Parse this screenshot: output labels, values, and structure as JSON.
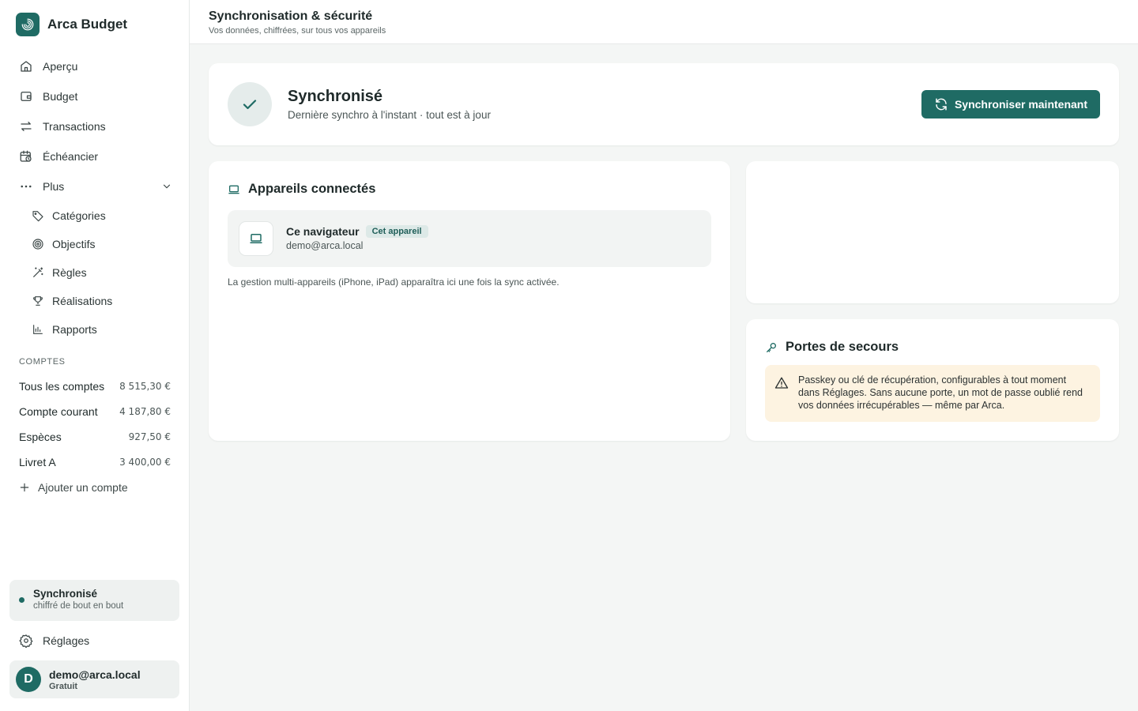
{
  "brand": {
    "name": "Arca Budget"
  },
  "nav": {
    "items": [
      {
        "label": "Aperçu"
      },
      {
        "label": "Budget"
      },
      {
        "label": "Transactions"
      },
      {
        "label": "Échéancier"
      },
      {
        "label": "Plus"
      }
    ],
    "sub_items": [
      {
        "label": "Catégories"
      },
      {
        "label": "Objectifs"
      },
      {
        "label": "Règles"
      },
      {
        "label": "Réalisations"
      },
      {
        "label": "Rapports"
      }
    ]
  },
  "accounts": {
    "title": "COMPTES",
    "items": [
      {
        "name": "Tous les comptes",
        "amount": "8 515,30 €"
      },
      {
        "name": "Compte courant",
        "amount": "4 187,80 €"
      },
      {
        "name": "Espèces",
        "amount": "927,50 €"
      },
      {
        "name": "Livret A",
        "amount": "3 400,00 €"
      }
    ],
    "add_label": "Ajouter un compte"
  },
  "sidebar_sync": {
    "title": "Synchronisé",
    "subtitle": "chiffré de bout en bout"
  },
  "settings_label": "Réglages",
  "user": {
    "initial": "D",
    "email": "demo@arca.local",
    "plan": "Gratuit"
  },
  "header": {
    "title": "Synchronisation & sécurité",
    "subtitle": "Vos données, chiffrées, sur tous vos appareils"
  },
  "status": {
    "title": "Synchronisé",
    "subtitle": "Dernière synchro à l'instant · tout est à jour",
    "button_label": "Synchroniser maintenant"
  },
  "devices": {
    "title": "Appareils connectés",
    "device": {
      "name": "Ce navigateur",
      "badge": "Cet appareil",
      "email": "demo@arca.local"
    },
    "note": "La gestion multi-appareils (iPhone, iPad) apparaîtra ici une fois la sync activée."
  },
  "rescue": {
    "title": "Portes de secours",
    "warning_lines": [
      "Passkey ou clé de récupération, configurables à tout moment",
      "dans Réglages. Sans aucune porte, un mot de passe oublié rend",
      "vos données irrécupérables — même par Arca."
    ]
  },
  "colors": {
    "accent": "#1f6b64",
    "warning_bg": "#fdf3e1",
    "page_bg": "#f4f6f5"
  }
}
